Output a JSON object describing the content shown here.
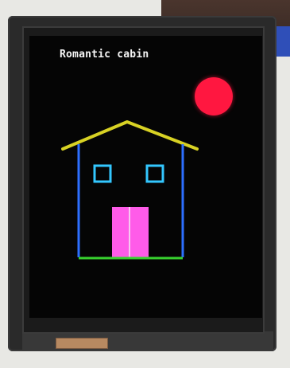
{
  "screen": {
    "title": "Romantic cabin"
  },
  "colors": {
    "background": "#050505",
    "title_text": "#f5f5f5",
    "sun": "#ff1740",
    "roof": "#d8d224",
    "walls": "#2d6fff",
    "windows": "#33c7ff",
    "door": "#ff5be9",
    "door_split": "#f7c7f0",
    "ground": "#38d12f"
  }
}
